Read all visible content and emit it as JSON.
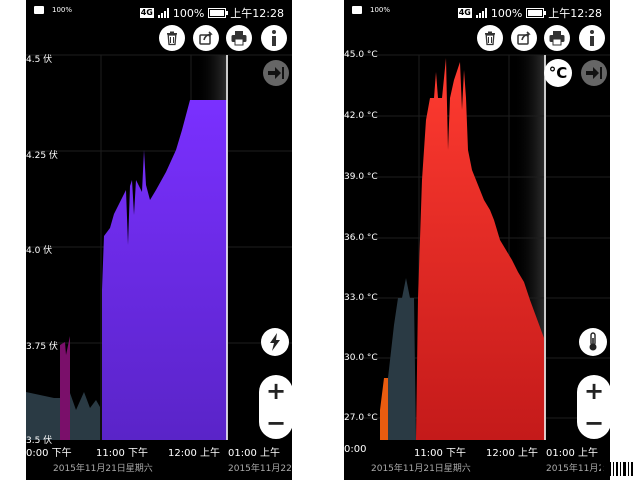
{
  "status_bar": {
    "battery_small": "100%",
    "network": "4G",
    "battery": "100%",
    "time": "上午12:28"
  },
  "toolbar_icons": [
    "trash-icon",
    "share-icon",
    "print-icon",
    "info-icon",
    "jump-to-end-icon"
  ],
  "left_panel": {
    "y_ticks": [
      "4.5 伏",
      "4.25 伏",
      "4.0 伏",
      "3.75 伏",
      "3.5 伏"
    ],
    "x_ticks": [
      "0:00 下午",
      "11:00 下午",
      "12:00 上午",
      "01:00 上午"
    ],
    "date_labels": [
      "2015年11月21日星期六",
      "2015年11月22"
    ],
    "mode_icon": "lightning-icon",
    "zoom_in": "+",
    "zoom_out": "−"
  },
  "right_panel": {
    "y_ticks": [
      "45.0 °C",
      "42.0 °C",
      "39.0 °C",
      "36.0 °C",
      "33.0 °C",
      "30.0 °C",
      "27.0 °C"
    ],
    "x_ticks": [
      "0:00",
      "11:00 下午",
      "12:00 上午",
      "01:00 上午"
    ],
    "date_labels": [
      "2015年11月21日星期六",
      "2015年11月2"
    ],
    "unit_toggle": "°C",
    "mode_icon": "thermometer-icon",
    "zoom_in": "+",
    "zoom_out": "−"
  },
  "colors": {
    "voltage_fill": "#6a28e8",
    "temperature_fill": "#e0262a",
    "prior_fill": "#2a3a44",
    "background": "#000000"
  }
}
